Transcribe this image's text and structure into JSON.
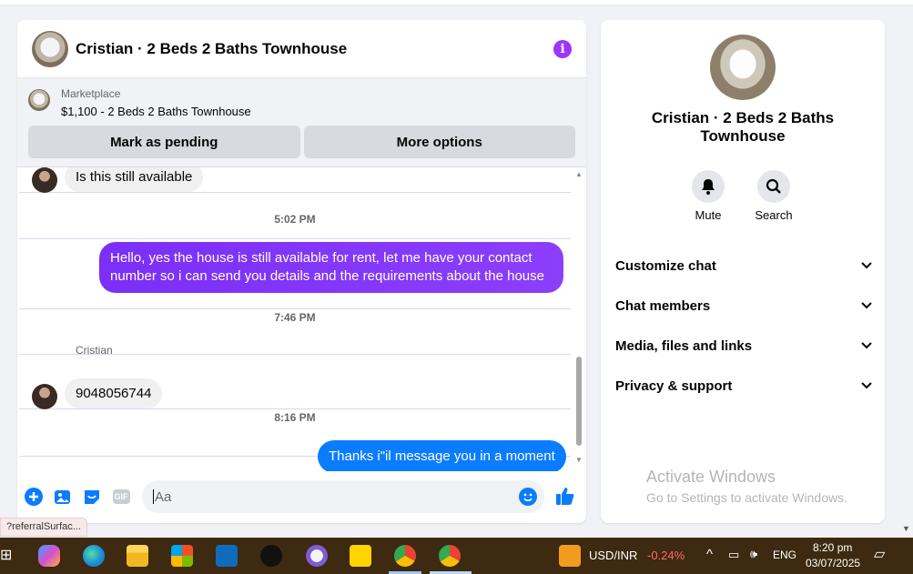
{
  "chat": {
    "title": "Cristian · 2 Beds 2 Baths Townhouse",
    "marketplace_label": "Marketplace",
    "listing": "$1,100 - 2 Beds 2 Baths Townhouse",
    "mark_pending": "Mark as pending",
    "more_options": "More options",
    "messages": {
      "m1": "Is this still available",
      "t1": "5:02 PM",
      "m2_line1": "Hello, yes the house is still available for rent, let me have your contact",
      "m2_line2": "number so i can send you details and the requirements about the house",
      "t2": "7:46 PM",
      "sender": "Cristian",
      "m3": "9048056744",
      "t3": "8:16 PM",
      "m4": "Thanks i\"il message you in a moment"
    },
    "composer_placeholder": "Aa",
    "gif_label": "GIF"
  },
  "side": {
    "name": "Cristian · 2 Beds 2 Baths Townhouse",
    "mute": "Mute",
    "search": "Search",
    "menu": [
      "Customize chat",
      "Chat members",
      "Media, files and links",
      "Privacy & support"
    ],
    "activate_title": "Activate Windows",
    "activate_sub": "Go to Settings to activate Windows."
  },
  "status_url": "?referralSurfac...",
  "taskbar": {
    "ticker": "USD/INR",
    "change": "-0.24%",
    "lang": "ENG",
    "time": "8:20 pm",
    "date": "03/07/2025"
  },
  "colors": {
    "accent_purple": "#a033ff",
    "bubble_gradient_purple": "#7b2ff7",
    "bubble_blue": "#0a7cff",
    "negative": "#ff6b6b"
  }
}
